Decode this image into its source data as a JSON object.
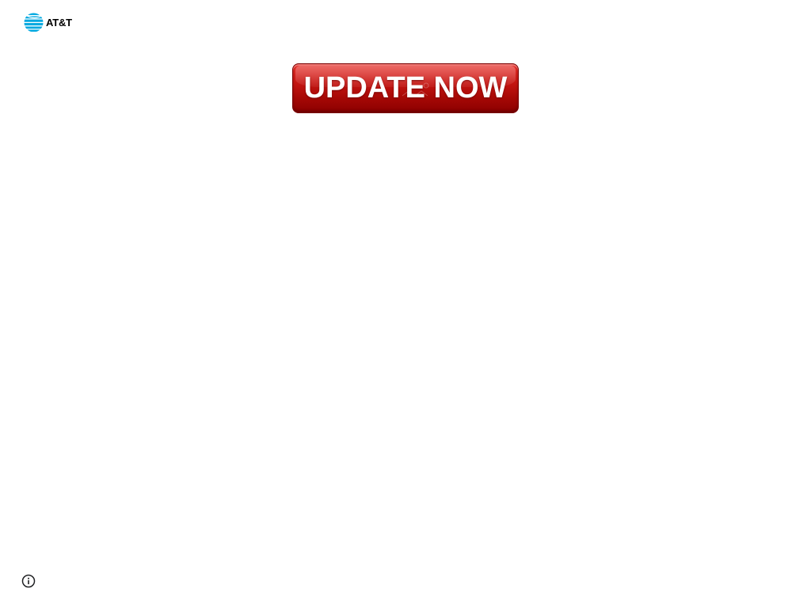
{
  "header": {
    "logo_text": "AT&T",
    "logo_icon": "att-globe-icon",
    "brand_color": "#00a8e0"
  },
  "main": {
    "update_button_label": "UPDATE NOW",
    "button_color": "#c91713"
  },
  "footer": {
    "info_icon": "info-icon"
  }
}
